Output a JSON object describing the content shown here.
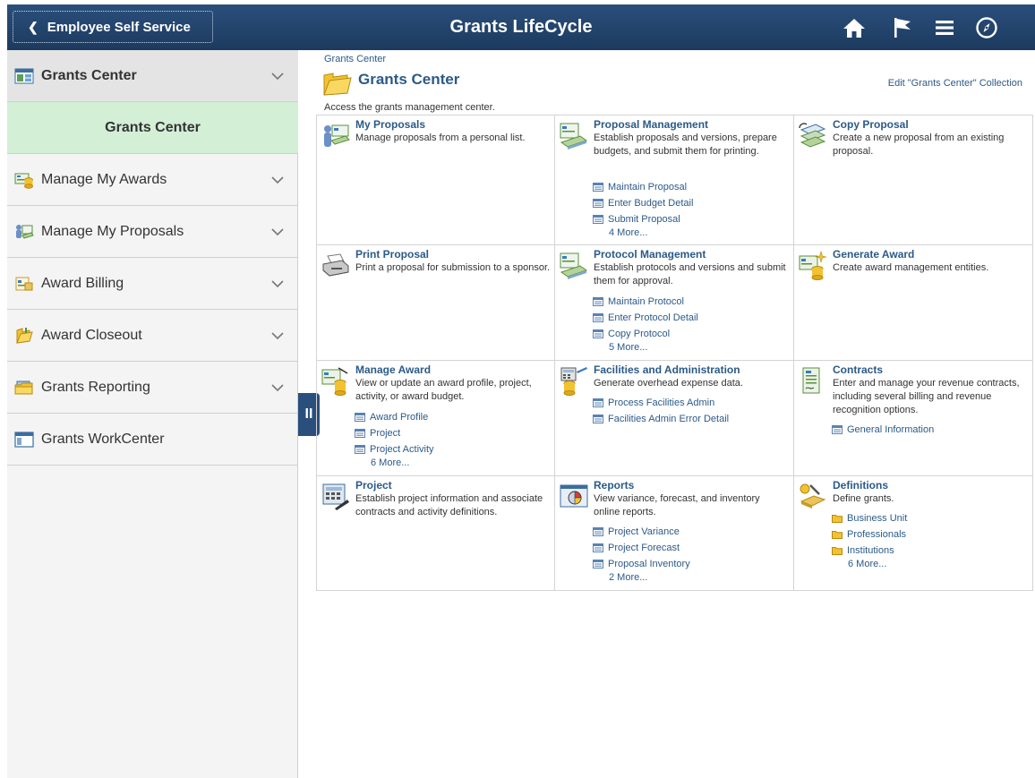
{
  "header": {
    "back_label": "Employee Self Service",
    "title": "Grants LifeCycle",
    "icons": [
      "home-icon",
      "flag-icon",
      "menu-icon",
      "navbar-compass-icon"
    ]
  },
  "sidebar": {
    "items": [
      {
        "label": "Grants Center",
        "icon": "grants-center-icon",
        "expandable": true,
        "style": "header"
      },
      {
        "label": "Grants Center",
        "style": "selected"
      },
      {
        "label": "Manage My Awards",
        "icon": "award-icon",
        "expandable": true
      },
      {
        "label": "Manage My Proposals",
        "icon": "proposals-icon",
        "expandable": true
      },
      {
        "label": "Award Billing",
        "icon": "billing-icon",
        "expandable": true
      },
      {
        "label": "Award Closeout",
        "icon": "folder-open-icon",
        "expandable": true
      },
      {
        "label": "Grants Reporting",
        "icon": "folder-stack-icon",
        "expandable": true
      },
      {
        "label": "Grants WorkCenter",
        "icon": "workcenter-icon",
        "expandable": false
      }
    ],
    "collapse_glyph": "II"
  },
  "page": {
    "breadcrumb": "Grants Center",
    "title": "Grants Center",
    "edit_link": "Edit \"Grants Center\" Collection",
    "description": "Access the grants management center."
  },
  "tiles": [
    {
      "title": "My Proposals",
      "icon": "person-book-icon",
      "description": "Manage proposals from a personal list.",
      "links": [],
      "more": ""
    },
    {
      "title": "Proposal Management",
      "icon": "document-book-icon",
      "description": "Establish proposals and versions, prepare budgets, and submit them for printing.",
      "links": [
        "Maintain Proposal",
        "Enter Budget Detail",
        "Submit Proposal"
      ],
      "more": "4 More..."
    },
    {
      "title": "Copy Proposal",
      "icon": "copy-books-icon",
      "description": "Create a new proposal from an existing proposal.",
      "links": [],
      "more": ""
    },
    {
      "title": "Print Proposal",
      "icon": "printer-icon",
      "description": "Print a proposal for submission to a sponsor.",
      "links": [],
      "more": ""
    },
    {
      "title": "Protocol Management",
      "icon": "document-book-icon",
      "description": "Establish protocols and versions and submit them for approval.",
      "links": [
        "Maintain Protocol",
        "Enter Protocol Detail",
        "Copy Protocol"
      ],
      "more": "5 More..."
    },
    {
      "title": "Generate Award",
      "icon": "award-sparkle-icon",
      "description": "Create award management entities.",
      "links": [],
      "more": ""
    },
    {
      "title": "Manage Award",
      "icon": "award-doc-icon",
      "description": "View or update an award profile, project, activity, or award budget.",
      "links": [
        "Award Profile",
        "Project",
        "Project Activity"
      ],
      "more": "6 More..."
    },
    {
      "title": "Facilities and Administration",
      "icon": "calculator-pen-icon",
      "description": "Generate overhead expense data.",
      "links": [
        "Process Facilities Admin",
        "Facilities Admin Error Detail"
      ],
      "more": ""
    },
    {
      "title": "Contracts",
      "icon": "contract-icon",
      "description": "Enter and manage your revenue contracts, including several billing and revenue recognition options.",
      "links": [
        "General Information"
      ],
      "more": ""
    },
    {
      "title": "Project",
      "icon": "calculator-icon",
      "description": "Establish project information and associate contracts and activity definitions.",
      "links": [],
      "more": ""
    },
    {
      "title": "Reports",
      "icon": "pie-chart-icon",
      "description": "View variance, forecast, and inventory online reports.",
      "links": [
        "Project Variance",
        "Project Forecast",
        "Proposal Inventory"
      ],
      "more": "2 More..."
    },
    {
      "title": "Definitions",
      "icon": "book-tools-icon",
      "description": "Define grants.",
      "links": [
        "Business Unit",
        "Professionals",
        "Institutions"
      ],
      "link_icon": "folder",
      "more": "6 More..."
    }
  ],
  "colors": {
    "header_bg": "#1f4068",
    "link": "#2b5a88",
    "selected_bg": "#d3efd6",
    "sidebar_bg": "#f4f4f4"
  }
}
